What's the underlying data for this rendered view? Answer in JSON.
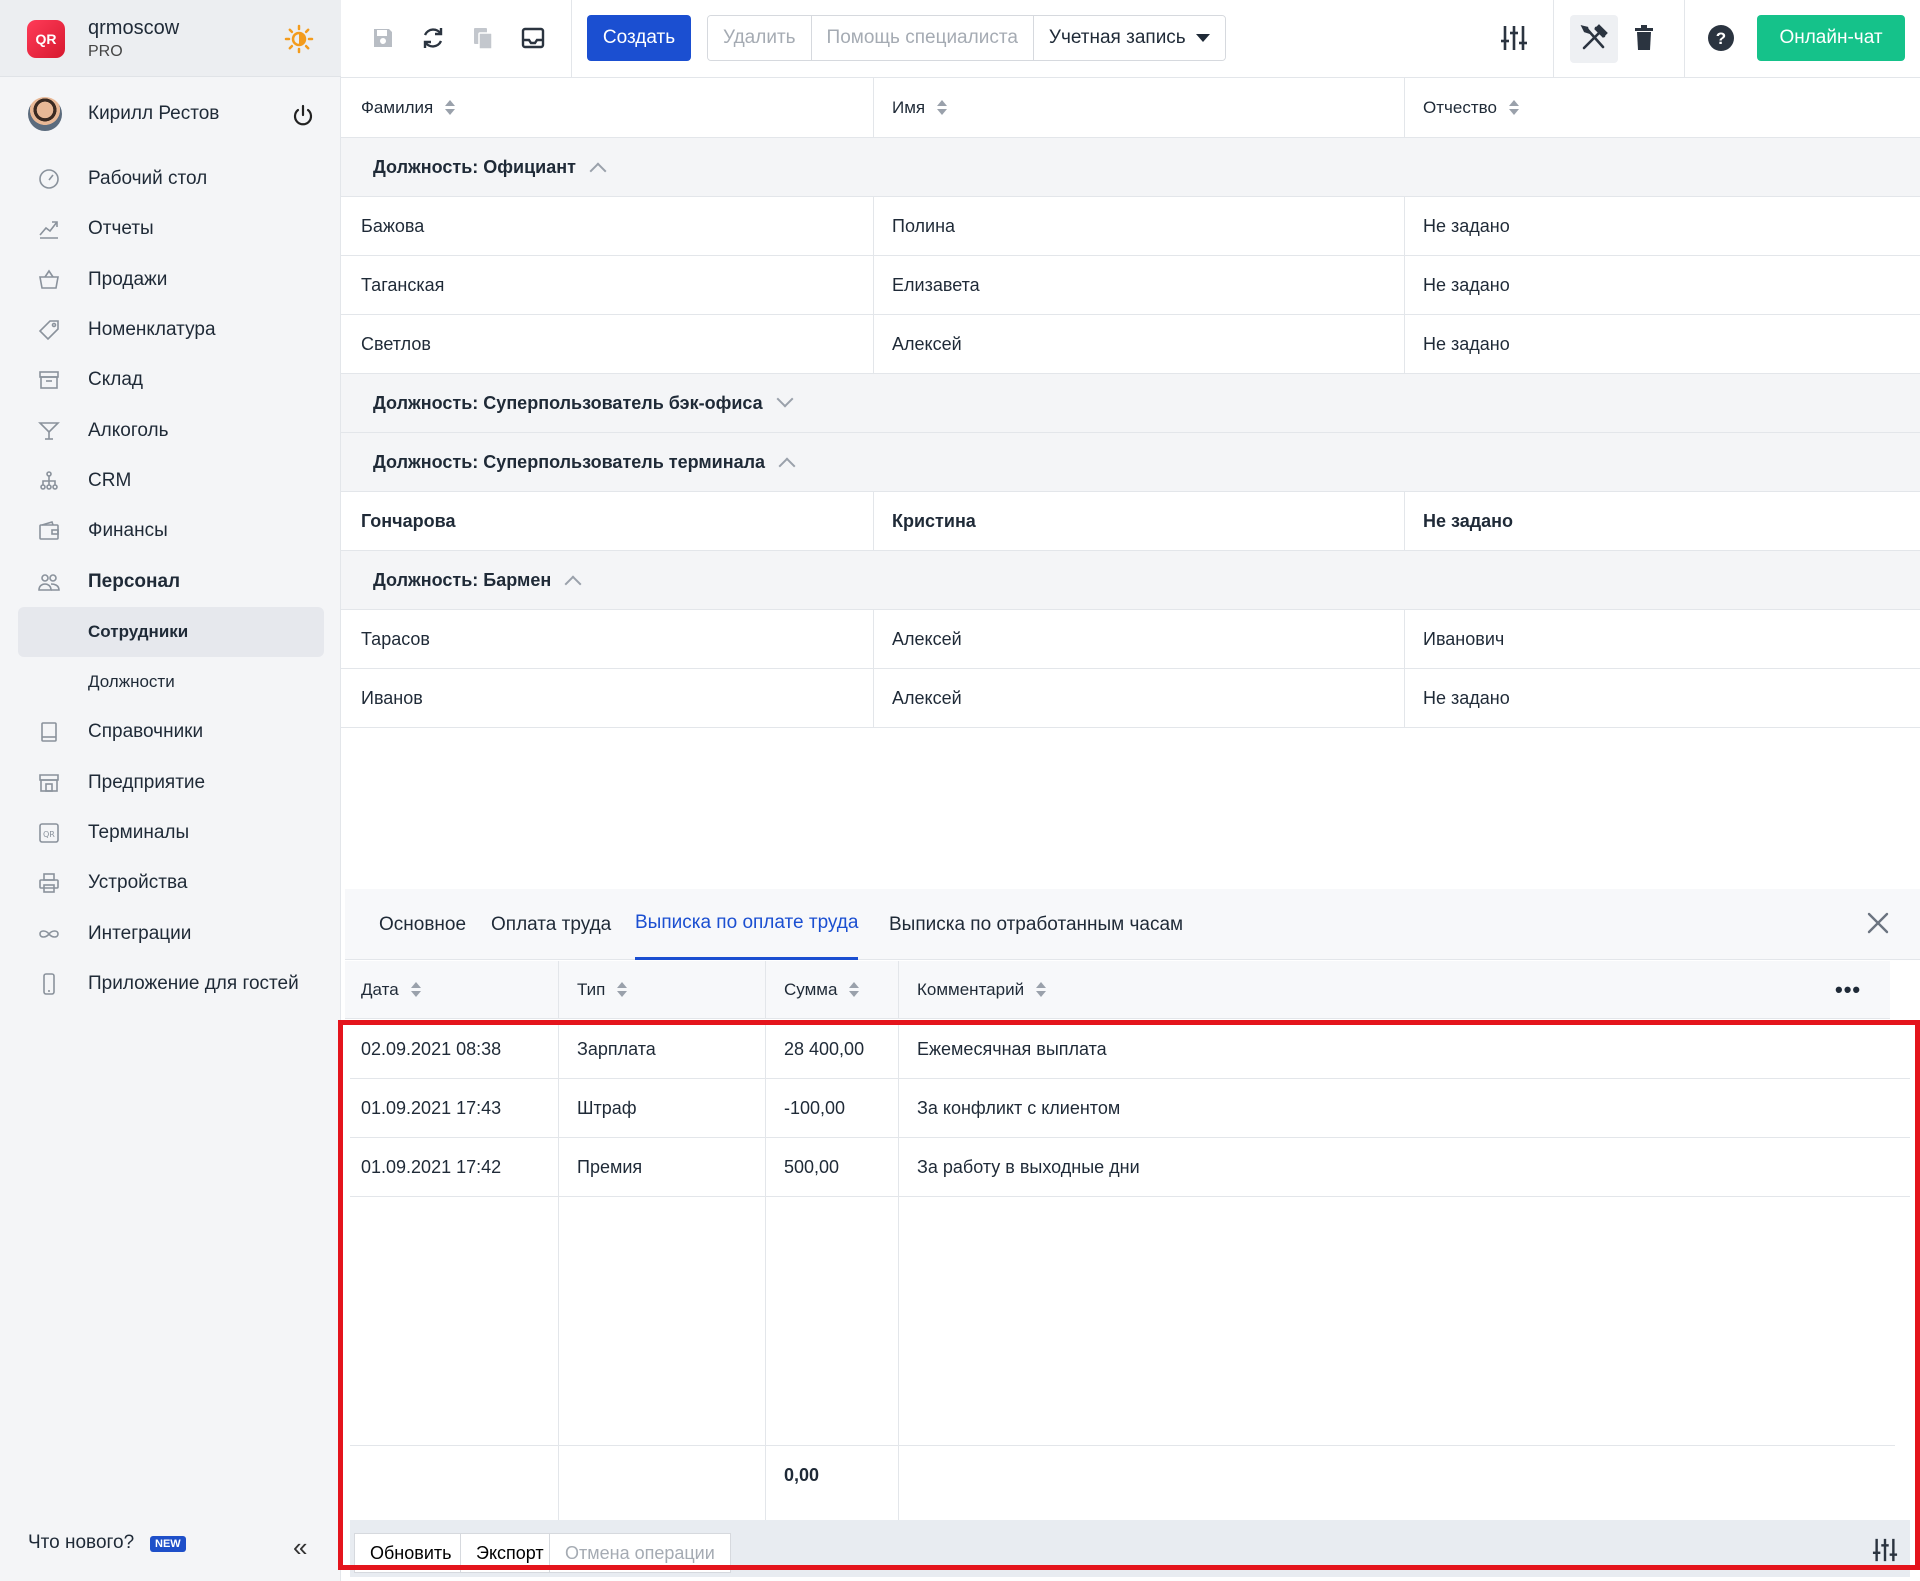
{
  "brand": {
    "name": "qrmoscow",
    "plan": "PRO",
    "logo": "QR"
  },
  "user": {
    "name": "Кирилл Рестов"
  },
  "menu": [
    {
      "label": "Рабочий стол",
      "icon": "dashboard-icon"
    },
    {
      "label": "Отчеты",
      "icon": "reports-icon"
    },
    {
      "label": "Продажи",
      "icon": "basket-icon"
    },
    {
      "label": "Номенклатура",
      "icon": "tag-icon"
    },
    {
      "label": "Склад",
      "icon": "box-icon"
    },
    {
      "label": "Алкоголь",
      "icon": "cocktail-icon"
    },
    {
      "label": "CRM",
      "icon": "hierarchy-icon"
    },
    {
      "label": "Финансы",
      "icon": "wallet-icon"
    },
    {
      "label": "Персонал",
      "icon": "people-icon"
    },
    {
      "label": "Сотрудники",
      "icon": ""
    },
    {
      "label": "Должности",
      "icon": ""
    },
    {
      "label": "Справочники",
      "icon": "book-icon"
    },
    {
      "label": "Предприятие",
      "icon": "store-icon"
    },
    {
      "label": "Терминалы",
      "icon": "terminal-icon"
    },
    {
      "label": "Устройства",
      "icon": "printer-icon"
    },
    {
      "label": "Интеграции",
      "icon": "infinity-icon"
    },
    {
      "label": "Приложение для гостей",
      "icon": "phone-icon"
    }
  ],
  "sidebar_footer": {
    "whats_new": "Что нового?",
    "badge": "NEW"
  },
  "toolbar": {
    "create": "Создать",
    "delete": "Удалить",
    "help": "Помощь специалиста",
    "account": "Учетная запись",
    "chat": "Онлайн-чат"
  },
  "table": {
    "headers": [
      "Фамилия",
      "Имя",
      "Отчество"
    ],
    "groups": [
      {
        "title": "Должность: Официант",
        "rows": [
          [
            "Бажова",
            "Полина",
            "Не задано"
          ],
          [
            "Таганская",
            "Елизавета",
            "Не задано"
          ],
          [
            "Светлов",
            "Алексей",
            "Не задано"
          ]
        ]
      },
      {
        "title": "Должность: Суперпользователь бэк-офиса",
        "rows": []
      },
      {
        "title": "Должность: Суперпользователь терминала",
        "rows": [
          [
            "Гончарова",
            "Кристина",
            "Не задано"
          ]
        ]
      },
      {
        "title": "Должность: Бармен",
        "rows": [
          [
            "Тарасов",
            "Алексей",
            "Иванович"
          ],
          [
            "Иванов",
            "Алексей",
            "Не задано"
          ]
        ]
      }
    ]
  },
  "panel": {
    "tabs": [
      "Основное",
      "Оплата труда",
      "Выписка по оплате труда",
      "Выписка по отработанным часам"
    ],
    "headers": [
      "Дата",
      "Тип",
      "Сумма",
      "Комментарий"
    ],
    "rows": [
      [
        "02.09.2021 08:38",
        "Зарплата",
        "28 400,00",
        "Ежемесячная выплата"
      ],
      [
        "01.09.2021 17:43",
        "Штраф",
        "-100,00",
        "За конфликт с клиентом"
      ],
      [
        "01.09.2021 17:42",
        "Премия",
        "500,00",
        "За работу в выходные дни"
      ]
    ],
    "total": "0,00",
    "buttons": [
      "Обновить",
      "Экспорт",
      "Отмена операции"
    ]
  },
  "colors": {
    "accent": "#1b4fd1",
    "chat": "#15c28a",
    "highlight": "#e4141c"
  }
}
